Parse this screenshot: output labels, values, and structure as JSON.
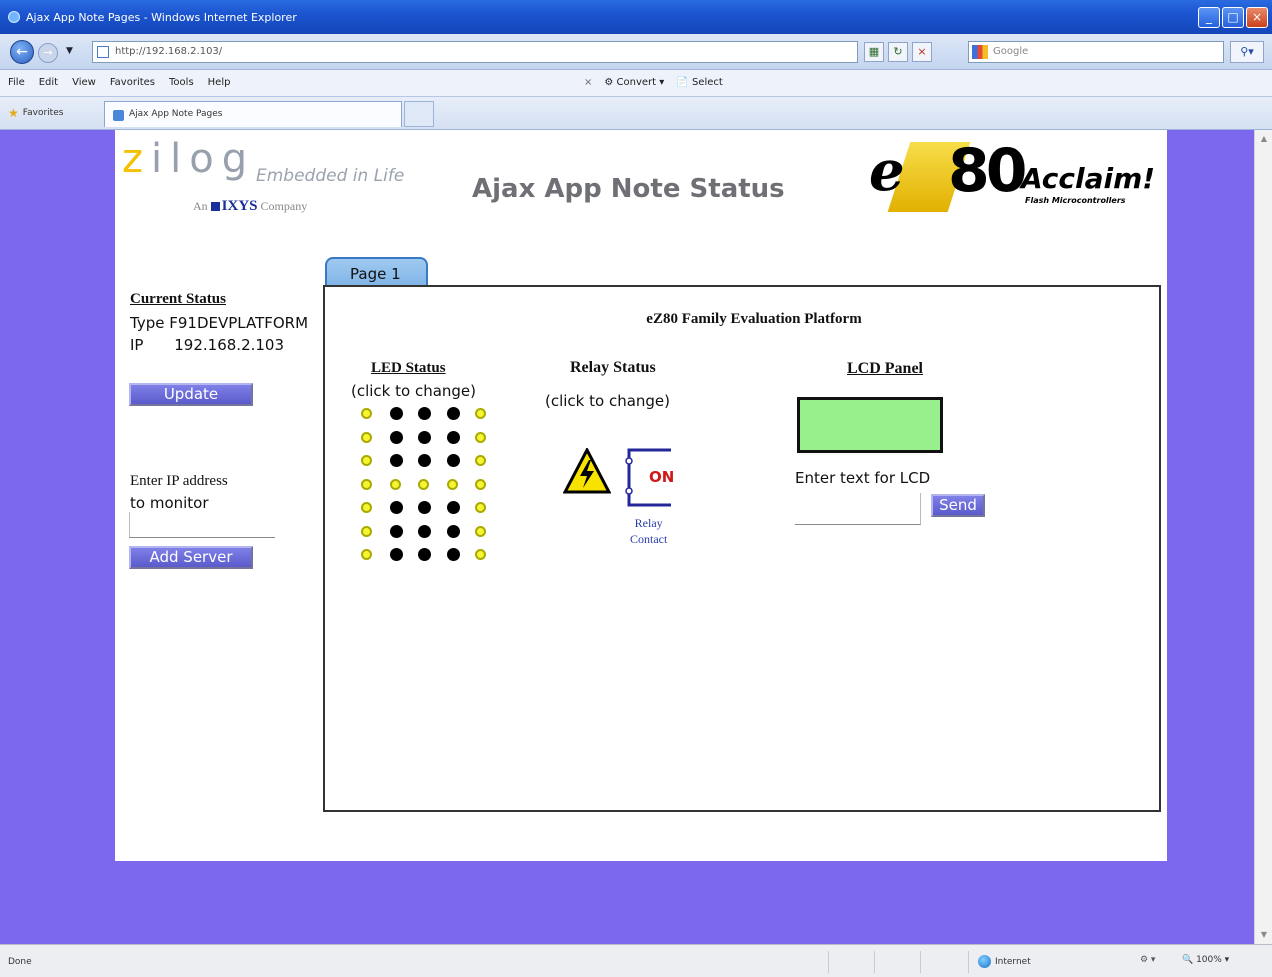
{
  "window": {
    "title": "Ajax App Note Pages - Windows Internet Explorer",
    "controls": {
      "minimize": "_",
      "maximize": "□",
      "close": "×"
    }
  },
  "browser": {
    "url": "http://192.168.2.103/",
    "search_placeholder": "Google",
    "menu": [
      "File",
      "Edit",
      "View",
      "Favorites",
      "Tools",
      "Help"
    ],
    "toolbar_right": {
      "close": "×",
      "convert": "Convert",
      "select": "Select"
    },
    "favorites_label": "Favorites",
    "tab_title": "Ajax App Note Pages",
    "status_text": "Done",
    "zone_text": "Internet",
    "zoom_text": "100%"
  },
  "page": {
    "title": "Ajax App Note Status",
    "zilog_logo": {
      "brand": "zilog",
      "tagline": "Embedded in Life",
      "parent": "An IXYS Company"
    },
    "ez80_logo": {
      "e": "e",
      "z80": "80",
      "acclaim": "Acclaim!",
      "flash": "Flash Microcontrollers"
    },
    "current_status": {
      "heading": "Current Status",
      "type_label": "Type",
      "type_value": "F91DEVPLATFORM",
      "ip_label": "IP",
      "ip_value": "192.168.2.103"
    },
    "update_button": "Update",
    "monitor": {
      "label_line1": "Enter IP address",
      "label_line2": "to monitor",
      "input_value": "",
      "add_button": "Add Server"
    },
    "tab_label": "Page 1",
    "panel_title": "eZ80 Family Evaluation Platform",
    "led": {
      "heading": "LED Status",
      "subheading": "(click to change)",
      "grid": [
        [
          0,
          1,
          1,
          1,
          0
        ],
        [
          0,
          1,
          1,
          1,
          0
        ],
        [
          0,
          1,
          1,
          1,
          0
        ],
        [
          0,
          0,
          0,
          0,
          0
        ],
        [
          0,
          1,
          1,
          1,
          0
        ],
        [
          0,
          1,
          1,
          1,
          0
        ],
        [
          0,
          1,
          1,
          1,
          0
        ]
      ]
    },
    "relay": {
      "heading": "Relay Status",
      "subheading": "(click to change)",
      "state": "ON",
      "label_line1": "Relay",
      "label_line2": "Contact",
      "colors": {
        "on_text": "#d01818",
        "label": "#2a3fa6"
      }
    },
    "lcd": {
      "heading": "LCD Panel",
      "screen_text": "",
      "prompt": "Enter text for LCD",
      "input_value": "",
      "send_button": "Send",
      "screen_color": "#98f08c"
    },
    "colors": {
      "background": "#7b68ee",
      "button": "#6a6ad8",
      "led_on": "#000000",
      "led_off": "#f5f535"
    }
  }
}
